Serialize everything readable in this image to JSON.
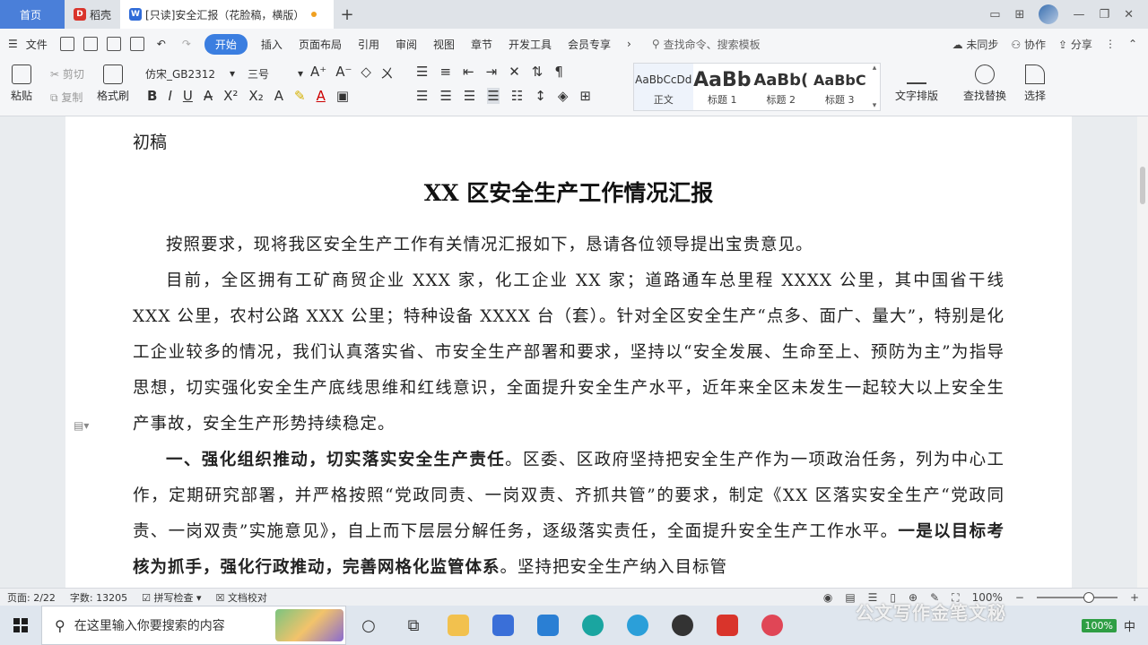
{
  "tabs": {
    "home": "首页",
    "daoke": "稻壳",
    "doc": "[只读]安全汇报（花脸稿，横版）",
    "daoke_logo": "D",
    "doc_logo": "W",
    "plus": "+"
  },
  "menu": {
    "file": "文件",
    "items": [
      "开始",
      "插入",
      "页面布局",
      "引用",
      "审阅",
      "视图",
      "章节",
      "开发工具",
      "会员专享"
    ],
    "more": "›",
    "search_placeholder": "查找命令、搜索模板",
    "unsync": "未同步",
    "collab": "协作",
    "share": "分享"
  },
  "ribbon": {
    "paste": "粘贴",
    "cut": "剪切",
    "copy": "复制",
    "format_painter": "格式刷",
    "font": "仿宋_GB2312",
    "size": "三号",
    "styles": [
      {
        "preview": "AaBbCcDd",
        "name": "正文"
      },
      {
        "preview": "AaBb",
        "name": "标题 1"
      },
      {
        "preview": "AaBb(",
        "name": "标题 2"
      },
      {
        "preview": "AaBbC",
        "name": "标题 3"
      }
    ],
    "text_layout": "文字排版",
    "find_replace": "查找替换",
    "select": "选择"
  },
  "document": {
    "draft_label": "初稿",
    "title": "XX 区安全生产工作情况汇报",
    "p1": "按照要求，现将我区安全生产工作有关情况汇报如下，恳请各位领导提出宝贵意见。",
    "p2": "目前，全区拥有工矿商贸企业 XXX 家，化工企业 XX 家；道路通车总里程 XXXX 公里，其中国省干线 XXX 公里，农村公路 XXX 公里；特种设备 XXXX 台（套）。针对全区安全生产“点多、面广、量大”，特别是化工企业较多的情况，我们认真落实省、市安全生产部署和要求，坚持以“安全发展、生命至上、预防为主”为指导思想，切实强化安全生产底线思维和红线意识，全面提升安全生产水平，近年来全区未发生一起较大以上安全生产事故，安全生产形势持续稳定。",
    "p3_bold": "一、强化组织推动，切实落实安全生产责任",
    "p3_text": "。区委、区政府坚持把安全生产作为一项政治任务，列为中心工作，定期研究部署，并严格按照“党政同责、一岗双责、齐抓共管”的要求，制定《XX 区落实安全生产“党政同责、一岗双责”实施意见》，自上而下层层分解任务，逐级落实责任，全面提升安全生产工作水平。",
    "p3_bold2": "一是以目标考核为抓手，强化行政推动，完善网格化监管体系",
    "p3_text2": "。坚持把安全生产纳入目标管"
  },
  "status": {
    "page": "页面: 2/22",
    "words": "字数: 13205",
    "spell": "拼写检查",
    "proof": "文档校对",
    "zoom": "100%"
  },
  "taskbar": {
    "search_placeholder": "在这里输入你要搜索的内容",
    "battery": "100%",
    "ime": "中",
    "watermark": "公文写作金笔文秘"
  }
}
